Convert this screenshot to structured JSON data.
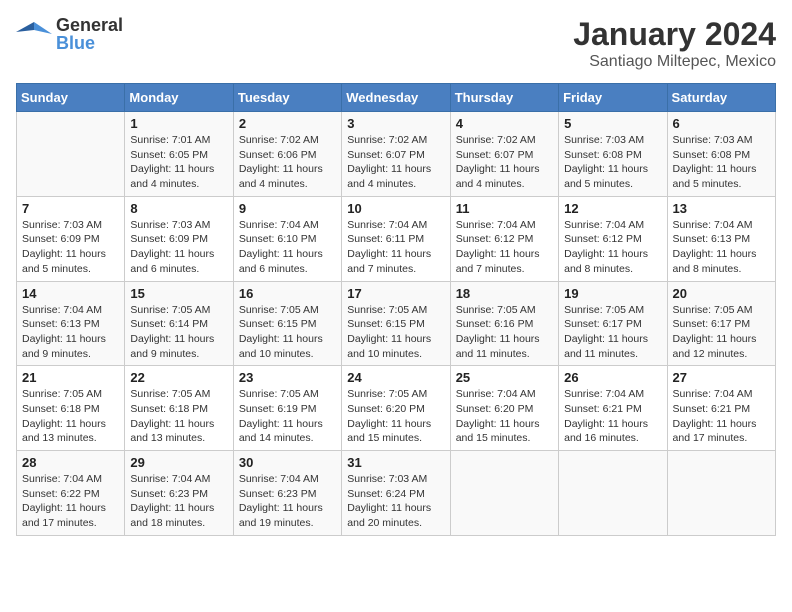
{
  "header": {
    "logo": {
      "general": "General",
      "blue": "Blue"
    },
    "title": "January 2024",
    "subtitle": "Santiago Miltepec, Mexico"
  },
  "days_of_week": [
    "Sunday",
    "Monday",
    "Tuesday",
    "Wednesday",
    "Thursday",
    "Friday",
    "Saturday"
  ],
  "weeks": [
    [
      {
        "day": "",
        "sunrise": "",
        "sunset": "",
        "daylight": ""
      },
      {
        "day": "1",
        "sunrise": "Sunrise: 7:01 AM",
        "sunset": "Sunset: 6:05 PM",
        "daylight": "Daylight: 11 hours and 4 minutes."
      },
      {
        "day": "2",
        "sunrise": "Sunrise: 7:02 AM",
        "sunset": "Sunset: 6:06 PM",
        "daylight": "Daylight: 11 hours and 4 minutes."
      },
      {
        "day": "3",
        "sunrise": "Sunrise: 7:02 AM",
        "sunset": "Sunset: 6:07 PM",
        "daylight": "Daylight: 11 hours and 4 minutes."
      },
      {
        "day": "4",
        "sunrise": "Sunrise: 7:02 AM",
        "sunset": "Sunset: 6:07 PM",
        "daylight": "Daylight: 11 hours and 4 minutes."
      },
      {
        "day": "5",
        "sunrise": "Sunrise: 7:03 AM",
        "sunset": "Sunset: 6:08 PM",
        "daylight": "Daylight: 11 hours and 5 minutes."
      },
      {
        "day": "6",
        "sunrise": "Sunrise: 7:03 AM",
        "sunset": "Sunset: 6:08 PM",
        "daylight": "Daylight: 11 hours and 5 minutes."
      }
    ],
    [
      {
        "day": "7",
        "sunrise": "Sunrise: 7:03 AM",
        "sunset": "Sunset: 6:09 PM",
        "daylight": "Daylight: 11 hours and 5 minutes."
      },
      {
        "day": "8",
        "sunrise": "Sunrise: 7:03 AM",
        "sunset": "Sunset: 6:09 PM",
        "daylight": "Daylight: 11 hours and 6 minutes."
      },
      {
        "day": "9",
        "sunrise": "Sunrise: 7:04 AM",
        "sunset": "Sunset: 6:10 PM",
        "daylight": "Daylight: 11 hours and 6 minutes."
      },
      {
        "day": "10",
        "sunrise": "Sunrise: 7:04 AM",
        "sunset": "Sunset: 6:11 PM",
        "daylight": "Daylight: 11 hours and 7 minutes."
      },
      {
        "day": "11",
        "sunrise": "Sunrise: 7:04 AM",
        "sunset": "Sunset: 6:12 PM",
        "daylight": "Daylight: 11 hours and 7 minutes."
      },
      {
        "day": "12",
        "sunrise": "Sunrise: 7:04 AM",
        "sunset": "Sunset: 6:12 PM",
        "daylight": "Daylight: 11 hours and 8 minutes."
      },
      {
        "day": "13",
        "sunrise": "Sunrise: 7:04 AM",
        "sunset": "Sunset: 6:13 PM",
        "daylight": "Daylight: 11 hours and 8 minutes."
      }
    ],
    [
      {
        "day": "14",
        "sunrise": "Sunrise: 7:04 AM",
        "sunset": "Sunset: 6:13 PM",
        "daylight": "Daylight: 11 hours and 9 minutes."
      },
      {
        "day": "15",
        "sunrise": "Sunrise: 7:05 AM",
        "sunset": "Sunset: 6:14 PM",
        "daylight": "Daylight: 11 hours and 9 minutes."
      },
      {
        "day": "16",
        "sunrise": "Sunrise: 7:05 AM",
        "sunset": "Sunset: 6:15 PM",
        "daylight": "Daylight: 11 hours and 10 minutes."
      },
      {
        "day": "17",
        "sunrise": "Sunrise: 7:05 AM",
        "sunset": "Sunset: 6:15 PM",
        "daylight": "Daylight: 11 hours and 10 minutes."
      },
      {
        "day": "18",
        "sunrise": "Sunrise: 7:05 AM",
        "sunset": "Sunset: 6:16 PM",
        "daylight": "Daylight: 11 hours and 11 minutes."
      },
      {
        "day": "19",
        "sunrise": "Sunrise: 7:05 AM",
        "sunset": "Sunset: 6:17 PM",
        "daylight": "Daylight: 11 hours and 11 minutes."
      },
      {
        "day": "20",
        "sunrise": "Sunrise: 7:05 AM",
        "sunset": "Sunset: 6:17 PM",
        "daylight": "Daylight: 11 hours and 12 minutes."
      }
    ],
    [
      {
        "day": "21",
        "sunrise": "Sunrise: 7:05 AM",
        "sunset": "Sunset: 6:18 PM",
        "daylight": "Daylight: 11 hours and 13 minutes."
      },
      {
        "day": "22",
        "sunrise": "Sunrise: 7:05 AM",
        "sunset": "Sunset: 6:18 PM",
        "daylight": "Daylight: 11 hours and 13 minutes."
      },
      {
        "day": "23",
        "sunrise": "Sunrise: 7:05 AM",
        "sunset": "Sunset: 6:19 PM",
        "daylight": "Daylight: 11 hours and 14 minutes."
      },
      {
        "day": "24",
        "sunrise": "Sunrise: 7:05 AM",
        "sunset": "Sunset: 6:20 PM",
        "daylight": "Daylight: 11 hours and 15 minutes."
      },
      {
        "day": "25",
        "sunrise": "Sunrise: 7:04 AM",
        "sunset": "Sunset: 6:20 PM",
        "daylight": "Daylight: 11 hours and 15 minutes."
      },
      {
        "day": "26",
        "sunrise": "Sunrise: 7:04 AM",
        "sunset": "Sunset: 6:21 PM",
        "daylight": "Daylight: 11 hours and 16 minutes."
      },
      {
        "day": "27",
        "sunrise": "Sunrise: 7:04 AM",
        "sunset": "Sunset: 6:21 PM",
        "daylight": "Daylight: 11 hours and 17 minutes."
      }
    ],
    [
      {
        "day": "28",
        "sunrise": "Sunrise: 7:04 AM",
        "sunset": "Sunset: 6:22 PM",
        "daylight": "Daylight: 11 hours and 17 minutes."
      },
      {
        "day": "29",
        "sunrise": "Sunrise: 7:04 AM",
        "sunset": "Sunset: 6:23 PM",
        "daylight": "Daylight: 11 hours and 18 minutes."
      },
      {
        "day": "30",
        "sunrise": "Sunrise: 7:04 AM",
        "sunset": "Sunset: 6:23 PM",
        "daylight": "Daylight: 11 hours and 19 minutes."
      },
      {
        "day": "31",
        "sunrise": "Sunrise: 7:03 AM",
        "sunset": "Sunset: 6:24 PM",
        "daylight": "Daylight: 11 hours and 20 minutes."
      },
      {
        "day": "",
        "sunrise": "",
        "sunset": "",
        "daylight": ""
      },
      {
        "day": "",
        "sunrise": "",
        "sunset": "",
        "daylight": ""
      },
      {
        "day": "",
        "sunrise": "",
        "sunset": "",
        "daylight": ""
      }
    ]
  ]
}
